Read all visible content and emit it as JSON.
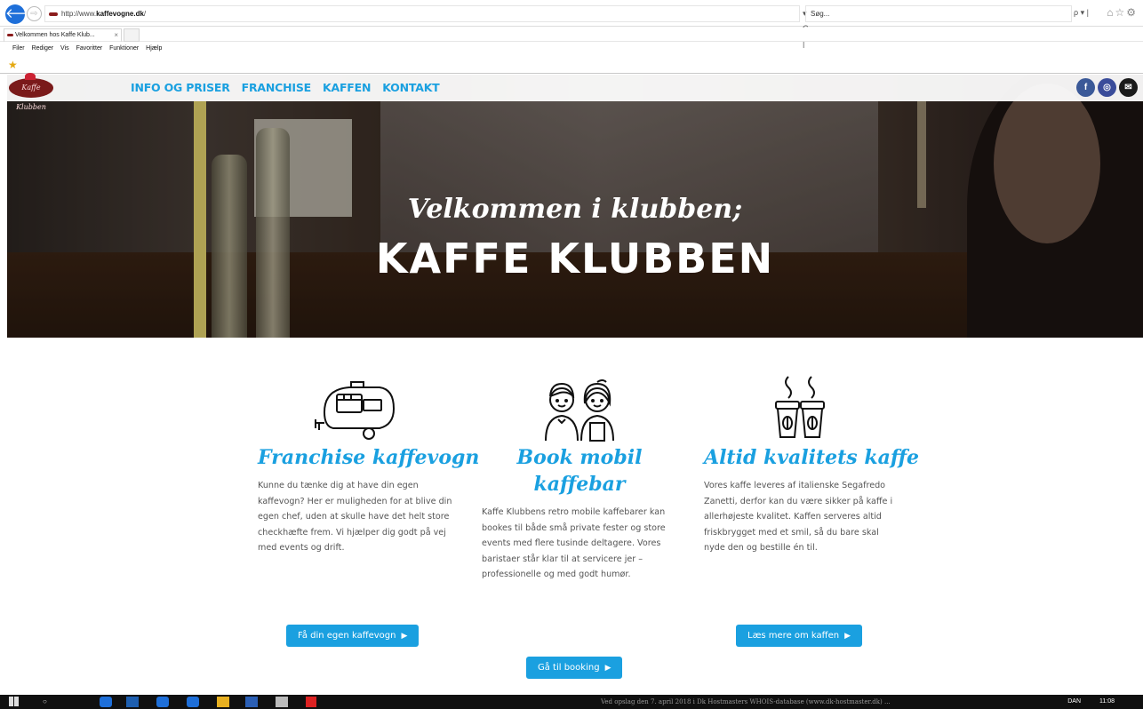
{
  "browser": {
    "back_glyph": "🡐",
    "forward_glyph": "⇨",
    "url_prefix": "http://www.",
    "url_domain": "kaffevogne.dk",
    "url_suffix": "/",
    "url_controls": "▾ C |",
    "search_placeholder": "Søg...",
    "search_controls": "ρ ▾ |",
    "toolbar_icons": "⌂☆⚙",
    "tab_title": "Velkommen hos Kaffe Klub...",
    "tab_close": "×",
    "menu": [
      "Filer",
      "Rediger",
      "Vis",
      "Favoritter",
      "Funktioner",
      "Hjælp"
    ],
    "fav_star": "★"
  },
  "site": {
    "logo_text": "Kaffe Klubben",
    "nav": [
      "INFO OG PRISER",
      "FRANCHISE",
      "KAFFEN",
      "KONTAKT"
    ],
    "social": {
      "facebook": "f",
      "instagram": "◎",
      "email": "✉"
    }
  },
  "hero": {
    "script_line": "Velkommen i klubben;",
    "title": "KAFFE KLUBBEN"
  },
  "features": [
    {
      "icon": "trailer-icon",
      "title": "Franchise kaffevogn",
      "text": "Kunne du tænke dig at have din egen kaffevogn? Her er muligheden for at blive din egen chef, uden at skulle have det helt store checkhæfte frem. Vi hjælper dig godt på vej med events og drift.",
      "button": "Få din egen kaffevogn"
    },
    {
      "icon": "baristas-icon",
      "title": "Book mobil kaffebar",
      "text": "Kaffe Klubbens retro mobile kaffebarer kan bookes til både små private fester og store events med flere tusinde deltagere. Vores baristaer står klar til at servicere jer – professionelle og med godt humør.",
      "button": "Gå til booking"
    },
    {
      "icon": "coffee-cups-icon",
      "title": "Altid kvalitets kaffe",
      "text": "Vores kaffe leveres af italienske Segafredo Zanetti, derfor kan du være sikker på kaffe i allerhøjeste kvalitet. Kaffen serveres altid friskbrygget med et smil, så du bare skal nyde den og bestille én til.",
      "button": "Læs mere om kaffen"
    }
  ],
  "button_arrow": "▶",
  "taskbar": {
    "search_glyph": "○",
    "background_text": "Ved opslag den 7. april 2018 i Dk Hostmasters WHOIS-database (www.dk-hostmaster.dk) ...",
    "lang": "DAN",
    "time": "11:08"
  },
  "colors": {
    "accent": "#1aa0e0",
    "facebook": "#3b5998",
    "logo": "#7a1a1a"
  }
}
